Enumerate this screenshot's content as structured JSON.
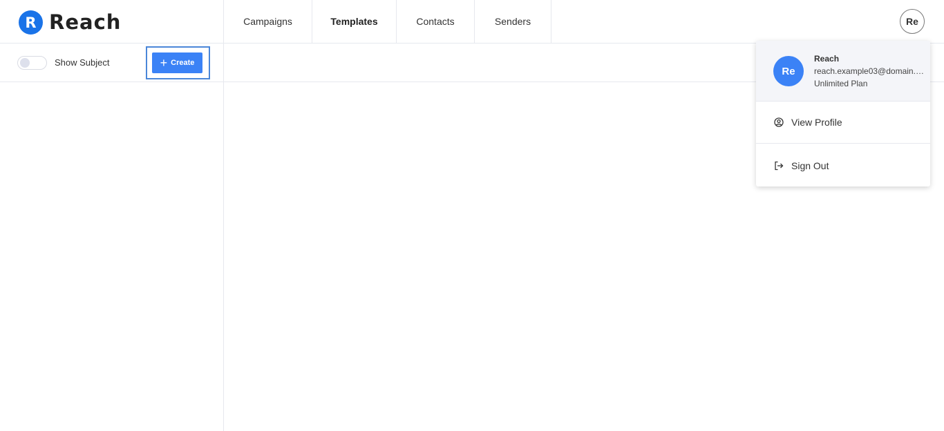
{
  "app": {
    "logo_letter": "R",
    "logo_text": "Reach",
    "brand_color": "#1a73e8"
  },
  "nav": {
    "tabs": [
      {
        "label": "Campaigns",
        "active": false
      },
      {
        "label": "Templates",
        "active": true
      },
      {
        "label": "Contacts",
        "active": false
      },
      {
        "label": "Senders",
        "active": false
      }
    ]
  },
  "header": {
    "avatar_initials": "Re"
  },
  "toolbar": {
    "show_subject_label": "Show Subject",
    "show_subject_on": false,
    "create_label": "Create",
    "create_icon": "plus-icon"
  },
  "profile_menu": {
    "avatar_initials": "Re",
    "name": "Reach",
    "email": "reach.example03@domain.c...",
    "plan": "Unlimited Plan",
    "items": [
      {
        "label": "View Profile",
        "icon": "user-circle-icon"
      },
      {
        "label": "Sign Out",
        "icon": "sign-out-icon"
      }
    ]
  }
}
